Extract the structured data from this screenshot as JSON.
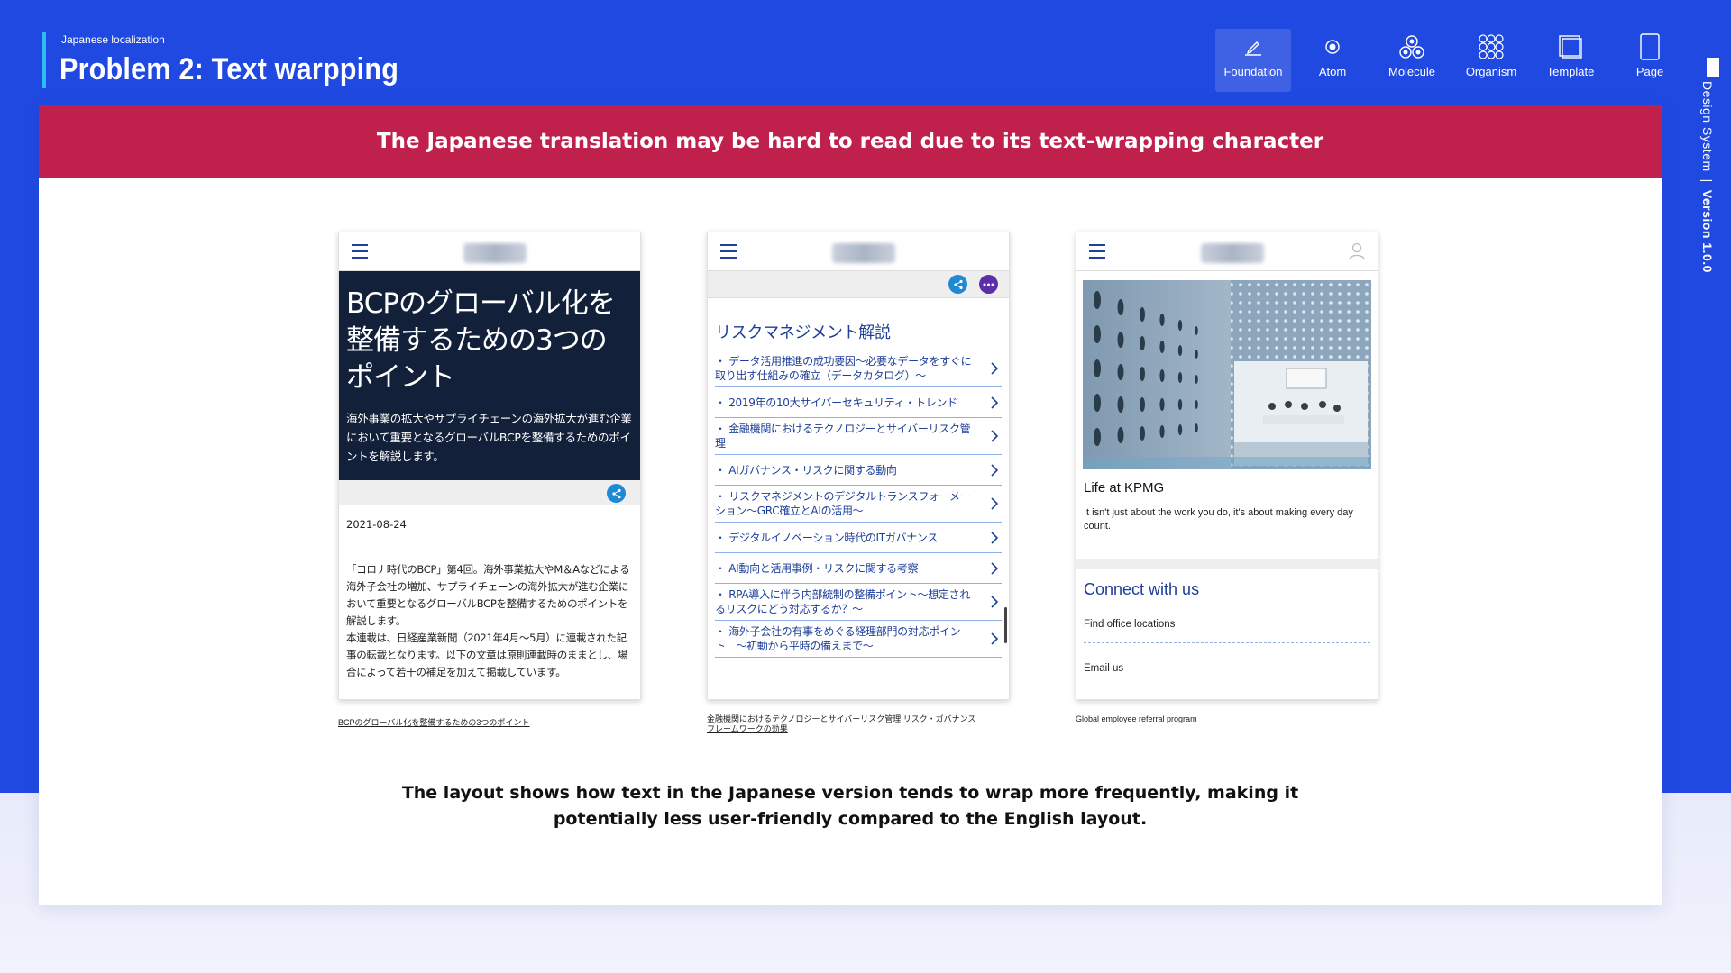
{
  "header": {
    "kicker": "Japanese localization",
    "title": "Problem 2: Text warpping"
  },
  "nav": {
    "items": [
      {
        "label": "Foundation",
        "icon": "pen-icon",
        "active": true
      },
      {
        "label": "Atom",
        "icon": "atom-icon",
        "active": false
      },
      {
        "label": "Molecule",
        "icon": "molecule-icon",
        "active": false
      },
      {
        "label": "Organism",
        "icon": "organism-icon",
        "active": false
      },
      {
        "label": "Template",
        "icon": "template-icon",
        "active": false
      },
      {
        "label": "Page",
        "icon": "page-icon",
        "active": false
      }
    ]
  },
  "side": {
    "label": "Design System",
    "sep": "|",
    "version": "Version 1.0.0"
  },
  "banner": "The Japanese translation may be hard to read due to its text-wrapping character",
  "phone1": {
    "title": "BCPのグローバル化を整備するための3つのポイント",
    "description": "海外事業の拡大やサプライチェーンの海外拡大が進む企業において重要となるグローバルBCPを整備するためのポイントを解説します。",
    "date": "2021-08-24",
    "body_1": "「コロナ時代のBCP」第4回。海外事業拡大やM＆Aなどによる海外子会社の増加、サプライチェーンの海外拡大が進む企業において重要となるグローバルBCPを整備するためのポイントを解説します。",
    "body_2": "本連載は、日経産業新聞（2021年4月〜5月）に連載された記事の転載となります。以下の文章は原則連載時のままとし、場合によって若干の補足を加えて掲載しています。",
    "caption": "BCPのグローバル化を整備するための3つのポイント"
  },
  "phone2": {
    "heading": "リスクマネジメント解説",
    "items": [
      "・ データ活用推進の成功要因〜必要なデータをすぐに取り出す仕組みの確立（データカタログ）〜",
      "・ 2019年の10大サイバーセキュリティ・トレンド",
      "・ 金融機関におけるテクノロジーとサイバーリスク管理",
      "・ AIガバナンス・リスクに関する動向",
      "・ リスクマネジメントのデジタルトランスフォーメーション〜GRC確立とAIの活用〜",
      "・ デジタルイノベーション時代のITガバナンス",
      "・ AI動向と活用事例・リスクに関する考察",
      "・ RPA導入に伴う内部統制の整備ポイント〜想定されるリスクにどう対応するか？〜",
      "・ 海外子会社の有事をめぐる経理部門の対応ポイント　〜初動から平時の備えまで〜"
    ],
    "caption": "金融機関におけるテクノロジーとサイバーリスク管理 リスク・ガバナンスフレームワークの効果"
  },
  "phone3": {
    "title": "Life at KPMG",
    "text": "It isn't just about the work you do, it's about making every day count.",
    "connect_title": "Connect with us",
    "links": [
      "Find office locations",
      "Email us"
    ],
    "caption": "Global employee referral program"
  },
  "bottom": {
    "line1": "The layout shows how text in the Japanese version tends to wrap more frequently, making it",
    "line2": "potentially less user-friendly compared to the English layout."
  },
  "colors": {
    "background": "#2049e1",
    "banner": "#c0204c",
    "accent_bar": "#2bbdf0",
    "link_blue": "#1e3f9a"
  }
}
